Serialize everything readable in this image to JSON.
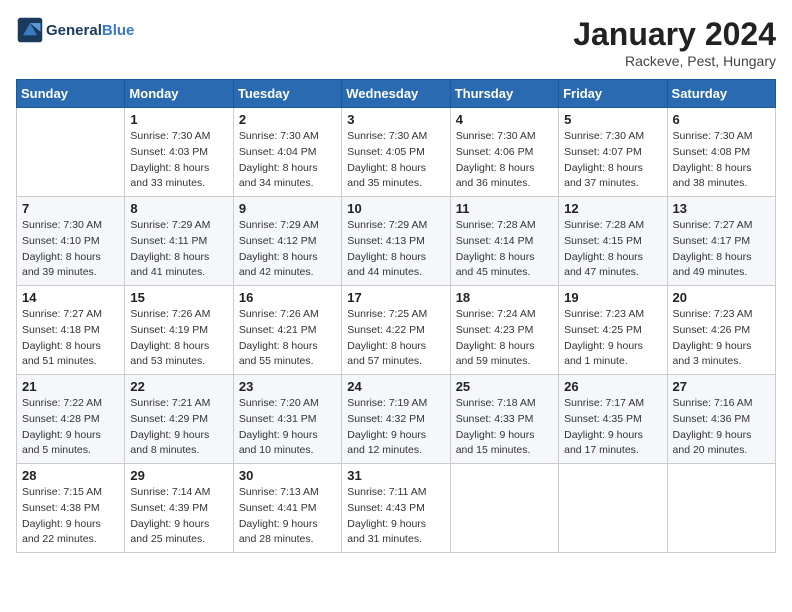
{
  "logo": {
    "line1": "General",
    "line2": "Blue"
  },
  "title": "January 2024",
  "location": "Rackeve, Pest, Hungary",
  "days_of_week": [
    "Sunday",
    "Monday",
    "Tuesday",
    "Wednesday",
    "Thursday",
    "Friday",
    "Saturday"
  ],
  "weeks": [
    [
      {
        "day": "",
        "info": ""
      },
      {
        "day": "1",
        "info": "Sunrise: 7:30 AM\nSunset: 4:03 PM\nDaylight: 8 hours\nand 33 minutes."
      },
      {
        "day": "2",
        "info": "Sunrise: 7:30 AM\nSunset: 4:04 PM\nDaylight: 8 hours\nand 34 minutes."
      },
      {
        "day": "3",
        "info": "Sunrise: 7:30 AM\nSunset: 4:05 PM\nDaylight: 8 hours\nand 35 minutes."
      },
      {
        "day": "4",
        "info": "Sunrise: 7:30 AM\nSunset: 4:06 PM\nDaylight: 8 hours\nand 36 minutes."
      },
      {
        "day": "5",
        "info": "Sunrise: 7:30 AM\nSunset: 4:07 PM\nDaylight: 8 hours\nand 37 minutes."
      },
      {
        "day": "6",
        "info": "Sunrise: 7:30 AM\nSunset: 4:08 PM\nDaylight: 8 hours\nand 38 minutes."
      }
    ],
    [
      {
        "day": "7",
        "info": "Sunrise: 7:30 AM\nSunset: 4:10 PM\nDaylight: 8 hours\nand 39 minutes."
      },
      {
        "day": "8",
        "info": "Sunrise: 7:29 AM\nSunset: 4:11 PM\nDaylight: 8 hours\nand 41 minutes."
      },
      {
        "day": "9",
        "info": "Sunrise: 7:29 AM\nSunset: 4:12 PM\nDaylight: 8 hours\nand 42 minutes."
      },
      {
        "day": "10",
        "info": "Sunrise: 7:29 AM\nSunset: 4:13 PM\nDaylight: 8 hours\nand 44 minutes."
      },
      {
        "day": "11",
        "info": "Sunrise: 7:28 AM\nSunset: 4:14 PM\nDaylight: 8 hours\nand 45 minutes."
      },
      {
        "day": "12",
        "info": "Sunrise: 7:28 AM\nSunset: 4:15 PM\nDaylight: 8 hours\nand 47 minutes."
      },
      {
        "day": "13",
        "info": "Sunrise: 7:27 AM\nSunset: 4:17 PM\nDaylight: 8 hours\nand 49 minutes."
      }
    ],
    [
      {
        "day": "14",
        "info": "Sunrise: 7:27 AM\nSunset: 4:18 PM\nDaylight: 8 hours\nand 51 minutes."
      },
      {
        "day": "15",
        "info": "Sunrise: 7:26 AM\nSunset: 4:19 PM\nDaylight: 8 hours\nand 53 minutes."
      },
      {
        "day": "16",
        "info": "Sunrise: 7:26 AM\nSunset: 4:21 PM\nDaylight: 8 hours\nand 55 minutes."
      },
      {
        "day": "17",
        "info": "Sunrise: 7:25 AM\nSunset: 4:22 PM\nDaylight: 8 hours\nand 57 minutes."
      },
      {
        "day": "18",
        "info": "Sunrise: 7:24 AM\nSunset: 4:23 PM\nDaylight: 8 hours\nand 59 minutes."
      },
      {
        "day": "19",
        "info": "Sunrise: 7:23 AM\nSunset: 4:25 PM\nDaylight: 9 hours\nand 1 minute."
      },
      {
        "day": "20",
        "info": "Sunrise: 7:23 AM\nSunset: 4:26 PM\nDaylight: 9 hours\nand 3 minutes."
      }
    ],
    [
      {
        "day": "21",
        "info": "Sunrise: 7:22 AM\nSunset: 4:28 PM\nDaylight: 9 hours\nand 5 minutes."
      },
      {
        "day": "22",
        "info": "Sunrise: 7:21 AM\nSunset: 4:29 PM\nDaylight: 9 hours\nand 8 minutes."
      },
      {
        "day": "23",
        "info": "Sunrise: 7:20 AM\nSunset: 4:31 PM\nDaylight: 9 hours\nand 10 minutes."
      },
      {
        "day": "24",
        "info": "Sunrise: 7:19 AM\nSunset: 4:32 PM\nDaylight: 9 hours\nand 12 minutes."
      },
      {
        "day": "25",
        "info": "Sunrise: 7:18 AM\nSunset: 4:33 PM\nDaylight: 9 hours\nand 15 minutes."
      },
      {
        "day": "26",
        "info": "Sunrise: 7:17 AM\nSunset: 4:35 PM\nDaylight: 9 hours\nand 17 minutes."
      },
      {
        "day": "27",
        "info": "Sunrise: 7:16 AM\nSunset: 4:36 PM\nDaylight: 9 hours\nand 20 minutes."
      }
    ],
    [
      {
        "day": "28",
        "info": "Sunrise: 7:15 AM\nSunset: 4:38 PM\nDaylight: 9 hours\nand 22 minutes."
      },
      {
        "day": "29",
        "info": "Sunrise: 7:14 AM\nSunset: 4:39 PM\nDaylight: 9 hours\nand 25 minutes."
      },
      {
        "day": "30",
        "info": "Sunrise: 7:13 AM\nSunset: 4:41 PM\nDaylight: 9 hours\nand 28 minutes."
      },
      {
        "day": "31",
        "info": "Sunrise: 7:11 AM\nSunset: 4:43 PM\nDaylight: 9 hours\nand 31 minutes."
      },
      {
        "day": "",
        "info": ""
      },
      {
        "day": "",
        "info": ""
      },
      {
        "day": "",
        "info": ""
      }
    ]
  ]
}
